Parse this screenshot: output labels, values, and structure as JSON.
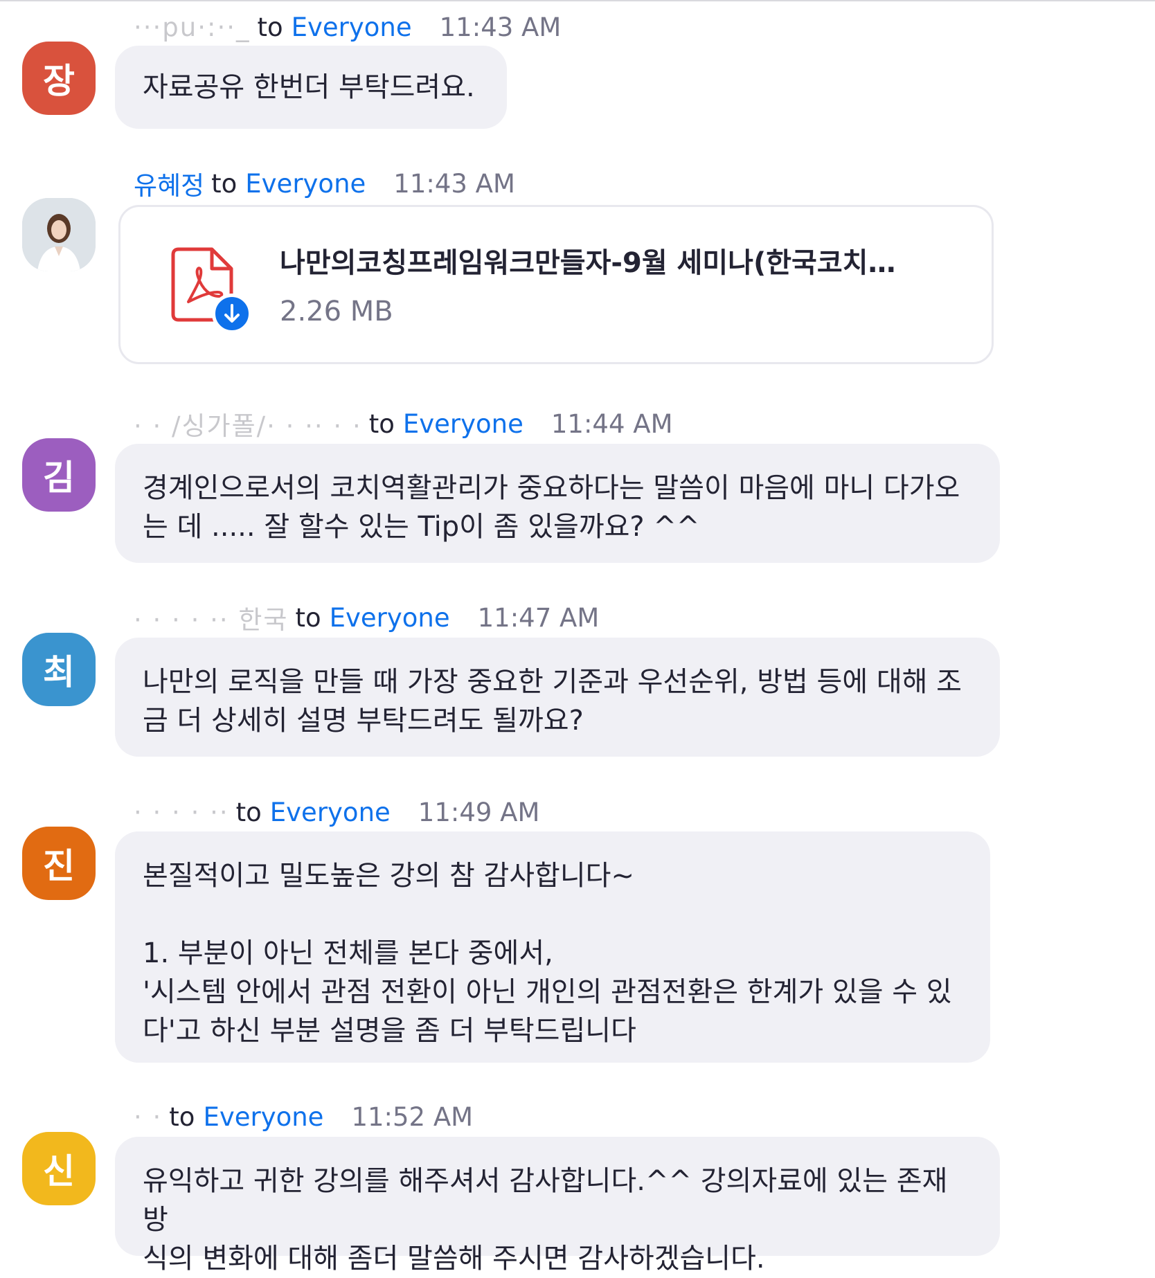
{
  "colors": {
    "link_blue": "#0e71eb",
    "bubble_bg": "#f0f0f5",
    "time_gray": "#747487"
  },
  "messages": [
    {
      "avatar": {
        "initial": "장",
        "color": "#d9523d"
      },
      "sender": "···pu·:··_",
      "to": "to",
      "recipient": "Everyone",
      "time": "11:43 AM",
      "text": "자료공유 한번더 부탁드려요."
    },
    {
      "avatar": {
        "initial": "",
        "color": "#d7dde3",
        "type": "photo"
      },
      "sender": "유혜정",
      "to": "to",
      "recipient": "Everyone",
      "time": "11:43 AM",
      "file": {
        "icon": "pdf-file-icon",
        "download_icon": "download-arrow-icon",
        "name": "나만의코칭프레임워크만들자-9월 세미나(한국코치…",
        "size": "2.26 MB"
      }
    },
    {
      "avatar": {
        "initial": "김",
        "color": "#9c5ebf"
      },
      "sender": "·  · /싱가폴/·  · ·· · ·",
      "to": "to",
      "recipient": "Everyone",
      "time": "11:44 AM",
      "text": "경계인으로서의 코치역활관리가 중요하다는 말씀이 마음에 마니 다가오\n는 데 .....   잘 할수 있는 Tip이 좀 있을까요?  ^^"
    },
    {
      "avatar": {
        "initial": "최",
        "color": "#3a94cf"
      },
      "sender": "·  ·  ·  · ·· 한국",
      "to": "to",
      "recipient": "Everyone",
      "time": "11:47 AM",
      "text": "나만의 로직을 만들 때 가장 중요한 기준과 우선순위, 방법 등에 대해 조\n금 더 상세히 설명 부탁드려도 될까요?"
    },
    {
      "avatar": {
        "initial": "진",
        "color": "#e16b12"
      },
      "sender": "·  ·  ·  ·  ··",
      "to": "to",
      "recipient": "Everyone",
      "time": "11:49 AM",
      "text": "본질적이고 밀도높은 강의 참 감사합니다~\n\n1. 부분이 아닌 전체를 본다 중에서,\n'시스템 안에서 관점 전환이 아닌 개인의 관점전환은 한계가 있을 수 있\n다'고 하신 부분 설명을 좀 더 부탁드립니다"
    },
    {
      "avatar": {
        "initial": "신",
        "color": "#f2b81d"
      },
      "sender": "·  ·",
      "to": "to",
      "recipient": "Everyone",
      "time": "11:52 AM",
      "text": "유익하고 귀한 강의를 해주셔서 감사합니다.^^ 강의자료에 있는 존재방\n식의 변화에 대해 좀더 말씀해 주시면 감사하겠습니다."
    }
  ]
}
